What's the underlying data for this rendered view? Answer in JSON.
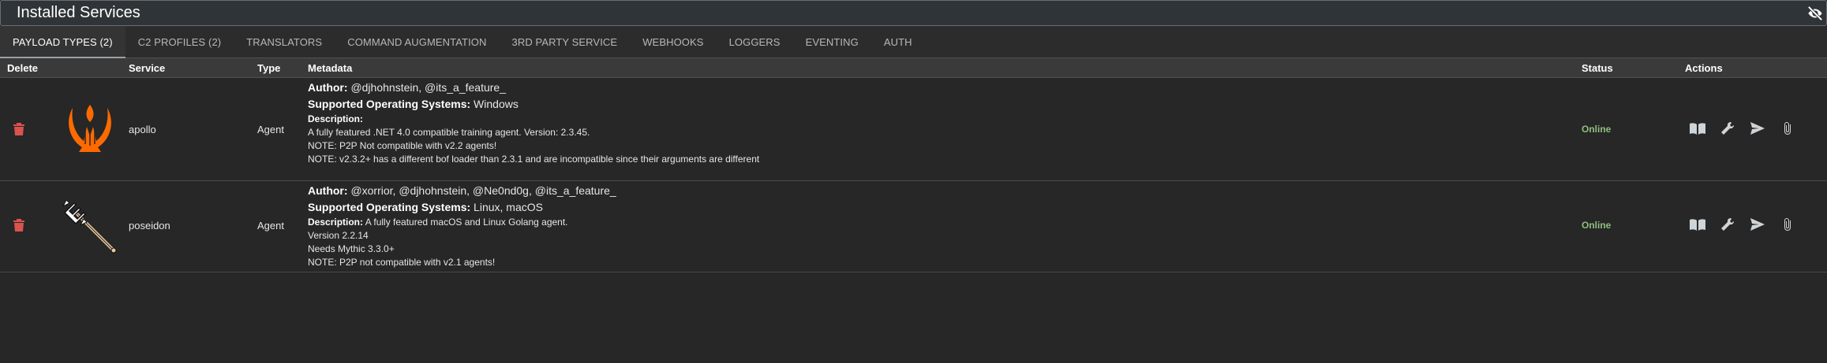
{
  "header": {
    "title": "Installed Services",
    "hide_icon": "eye-slash-icon"
  },
  "tabs": [
    {
      "label": "PAYLOAD TYPES (2)",
      "active": true
    },
    {
      "label": "C2 PROFILES (2)",
      "active": false
    },
    {
      "label": "TRANSLATORS",
      "active": false
    },
    {
      "label": "COMMAND AUGMENTATION",
      "active": false
    },
    {
      "label": "3RD PARTY SERVICE",
      "active": false
    },
    {
      "label": "WEBHOOKS",
      "active": false
    },
    {
      "label": "LOGGERS",
      "active": false
    },
    {
      "label": "EVENTING",
      "active": false
    },
    {
      "label": "AUTH",
      "active": false
    }
  ],
  "table": {
    "columns": {
      "delete": "Delete",
      "service": "Service",
      "type": "Type",
      "metadata": "Metadata",
      "status": "Status",
      "actions": "Actions"
    },
    "labels": {
      "author": "Author:",
      "os": "Supported Operating Systems:",
      "description": "Description:"
    },
    "rows": [
      {
        "service": "apollo",
        "type": "Agent",
        "icon": "lyre-icon",
        "author": "@djhohnstein, @its_a_feature_",
        "os": "Windows",
        "description_lines": [
          "A fully featured .NET 4.0 compatible training agent. Version: 2.3.45.",
          "NOTE: P2P Not compatible with v2.2 agents!",
          "NOTE: v2.3.2+ has a different bof loader than 2.3.1 and are incompatible since their arguments are different"
        ],
        "status": "Online"
      },
      {
        "service": "poseidon",
        "type": "Agent",
        "icon": "trident-icon",
        "author": "@xorrior, @djhohnstein, @Ne0nd0g, @its_a_feature_",
        "os": "Linux, macOS",
        "description_inline": "A fully featured macOS and Linux Golang agent.",
        "description_lines": [
          "Version 2.2.14",
          "Needs Mythic 3.3.0+",
          "NOTE: P2P not compatible with v2.1 agents!"
        ],
        "status": "Online"
      }
    ]
  },
  "colors": {
    "online": "#8fbf7f",
    "delete": "#d9534f",
    "apollo_icon": "#ff6a00"
  }
}
